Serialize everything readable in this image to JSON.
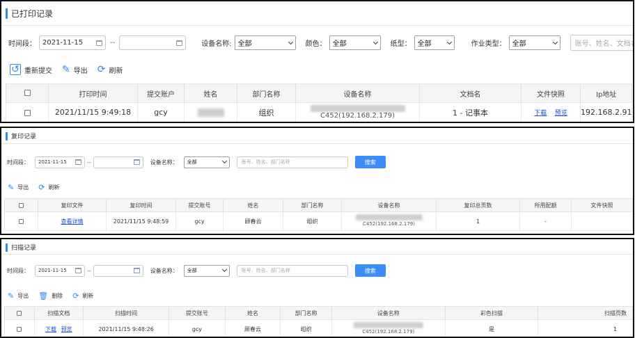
{
  "printed": {
    "title": "已打印记录",
    "filters": {
      "time_label": "时间段：",
      "date_from": "2021-11-15",
      "date_to": "",
      "sep": "--",
      "device_label": "设备名称:",
      "device_value": "全部",
      "color_label": "颜色：",
      "color_value": "全部",
      "paper_label": "纸型：",
      "paper_value": "全部",
      "job_label": "作业类型：",
      "job_value": "全部",
      "search_placeholder": "账号、姓名、文档名、"
    },
    "toolbar": {
      "resubmit": "重新提交",
      "export": "导出",
      "refresh": "刷新"
    },
    "columns": [
      "打印时间",
      "提交账户",
      "姓名",
      "部门名称",
      "设备名称",
      "文档名",
      "文件快照",
      "Ip地址"
    ],
    "row": {
      "time": "2021/11/15 9:49:18",
      "account": "gcy",
      "dept": "组织",
      "device": "C452(192.168.2.179)",
      "doc": "1 - 记事本",
      "download": "下载",
      "preview": "预览",
      "ip": "192.168.2.91"
    }
  },
  "copy": {
    "title": "复印记录",
    "filters": {
      "time_label": "时间段：",
      "date_from": "2021-11-15",
      "date_to": "",
      "sep": "--",
      "device_label": "设备名称：",
      "device_value": "全部",
      "search_placeholder": "账号、姓名、部门名称",
      "search_button": "搜索"
    },
    "toolbar": {
      "export": "导出",
      "refresh": "刷新"
    },
    "columns": [
      "复印文件",
      "复印时间",
      "提交账号",
      "姓名",
      "部门名称",
      "设备名称",
      "复印总页数",
      "所用配额",
      "文件快照"
    ],
    "row": {
      "file_link": "查看详情",
      "time": "2021/11/15 9:48:59",
      "account": "gcy",
      "name": "顾春云",
      "dept": "组织",
      "device": "C452(192.168.2.179)",
      "pages": "1",
      "quota": "-",
      "snapshot": ""
    }
  },
  "scan": {
    "title": "扫描记录",
    "filters": {
      "time_label": "时间段：",
      "date_from": "2021-11-15",
      "date_to": "",
      "sep": "--",
      "device_label": "设备名称：",
      "device_value": "全部",
      "search_placeholder": "账号、姓名、部门名称",
      "search_button": "搜索"
    },
    "toolbar": {
      "export": "导出",
      "delete": "删除",
      "refresh": "刷新"
    },
    "columns": [
      "扫描文档",
      "扫描时间",
      "提交账号",
      "姓名",
      "部门名称",
      "设备名称",
      "彩色扫描",
      "扫描页数"
    ],
    "row": {
      "download": "下载",
      "preview": "预览",
      "time": "2021/11/15 9:48:26",
      "account": "gcy",
      "name": "顾春云",
      "dept": "组织",
      "device": "C452(192.168.2.179)",
      "color": "是",
      "pages": "1"
    }
  },
  "colors": {
    "accent": "#2d8cf0",
    "button": "#3a8ef5",
    "link": "#1a4fd6",
    "header_bg": "#f4f5f7"
  }
}
